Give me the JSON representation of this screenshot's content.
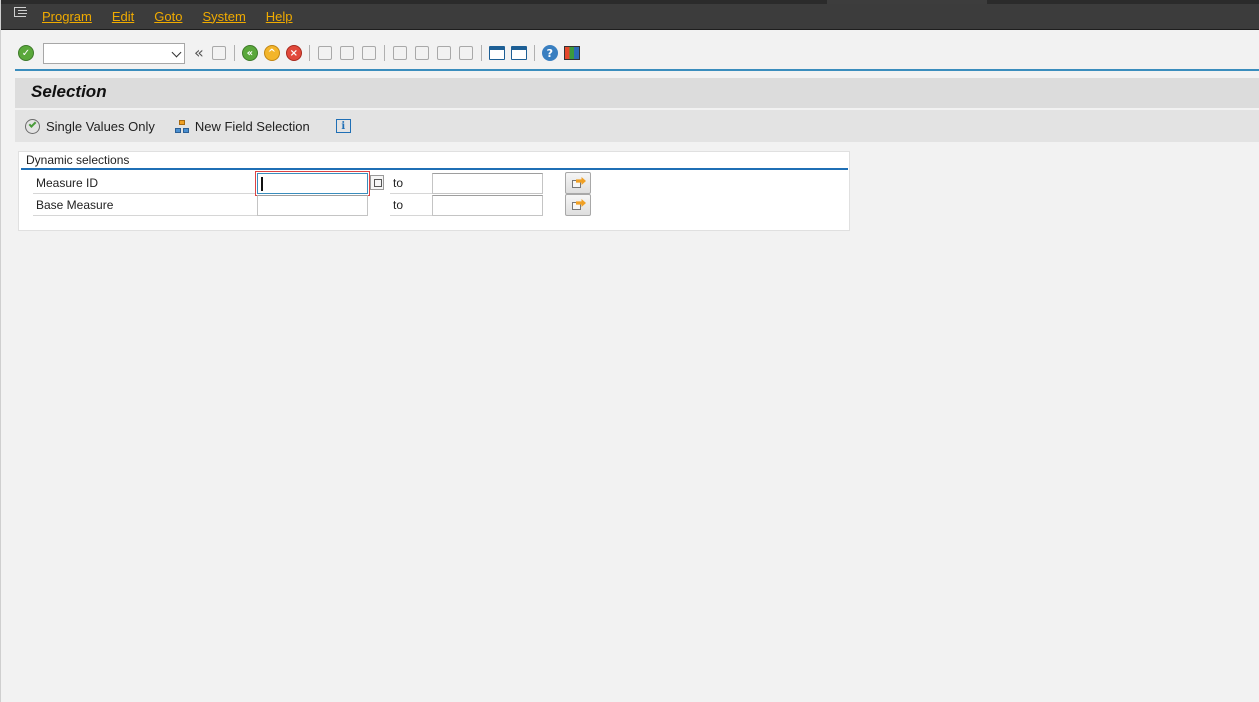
{
  "menu": {
    "items": [
      "Program",
      "Edit",
      "Goto",
      "System",
      "Help"
    ]
  },
  "toolbar": {
    "command_field_value": "",
    "icons": [
      "enter-icon",
      "back-icon",
      "save-icon",
      "exit-icon",
      "cancel-icon",
      "print-icon",
      "find-icon",
      "find-next-icon",
      "first-page-icon",
      "previous-page-icon",
      "next-page-icon",
      "last-page-icon",
      "new-session-icon",
      "shortcut-icon",
      "help-icon",
      "layout-icon"
    ]
  },
  "page": {
    "title": "Selection"
  },
  "app_toolbar": {
    "single_values_label": "Single Values Only",
    "new_field_selection_label": "New Field Selection"
  },
  "group": {
    "title": "Dynamic selections",
    "rows": [
      {
        "label": "Measure ID",
        "from": "",
        "to_label": "to",
        "to": ""
      },
      {
        "label": "Base Measure",
        "from": "",
        "to_label": "to",
        "to": ""
      }
    ]
  },
  "colors": {
    "menu_text": "#f0ab00",
    "menu_bar": "#3c3c3c",
    "accent_line": "#3a8dbd"
  }
}
